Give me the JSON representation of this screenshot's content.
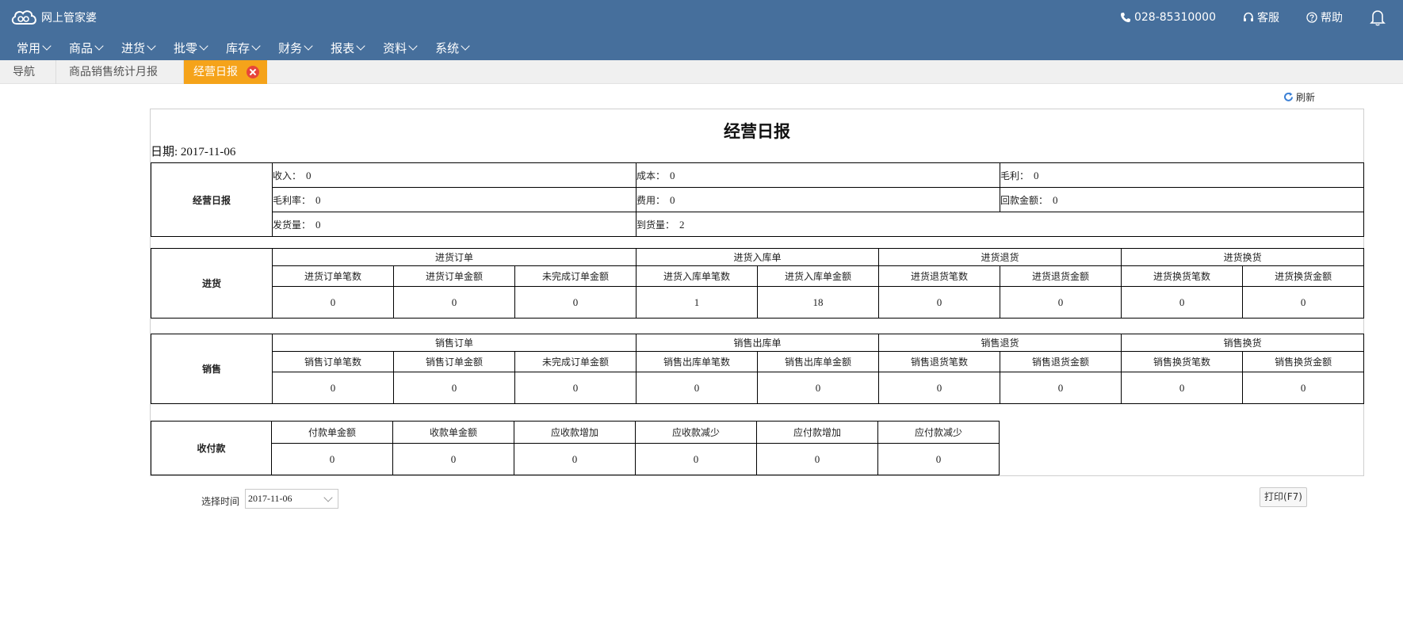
{
  "app": {
    "logo_text": "网上管家婆"
  },
  "topbar": {
    "phone": "028-85310000",
    "service": "客服",
    "help": "帮助"
  },
  "menu": [
    "常用",
    "商品",
    "进货",
    "批零",
    "库存",
    "财务",
    "报表",
    "资料",
    "系统"
  ],
  "tabs": [
    "导航",
    "商品销售统计月报",
    "经营日报"
  ],
  "toolbar": {
    "refresh": "刷新"
  },
  "report": {
    "title": "经营日报",
    "date_label": "日期:",
    "date_value": "2017-11-06",
    "summary": {
      "header": "经营日报",
      "income_label": "收入：",
      "income": "0",
      "cost_label": "成本：",
      "cost": "0",
      "gross_label": "毛利：",
      "gross": "0",
      "margin_label": "毛利率：",
      "margin": "0",
      "expense_label": "费用：",
      "expense": "0",
      "refund_label": "回款金额：",
      "refund": "0",
      "ship_label": "发货量：",
      "ship": "0",
      "arrive_label": "到货量：",
      "arrive": "2"
    },
    "purchase": {
      "header": "进货",
      "groups": [
        "进货订单",
        "进货入库单",
        "进货退货",
        "进货换货"
      ],
      "columns": [
        "进货订单笔数",
        "进货订单金额",
        "未完成订单金额",
        "进货入库单笔数",
        "进货入库单金额",
        "进货退货笔数",
        "进货退货金额",
        "进货换货笔数",
        "进货换货金额"
      ],
      "values": [
        "0",
        "0",
        "0",
        "1",
        "18",
        "0",
        "0",
        "0",
        "0"
      ]
    },
    "sales": {
      "header": "销售",
      "groups": [
        "销售订单",
        "销售出库单",
        "销售退货",
        "销售换货"
      ],
      "columns": [
        "销售订单笔数",
        "销售订单金额",
        "未完成订单金额",
        "销售出库单笔数",
        "销售出库单金额",
        "销售退货笔数",
        "销售退货金额",
        "销售换货笔数",
        "销售换货金额"
      ],
      "values": [
        "0",
        "0",
        "0",
        "0",
        "0",
        "0",
        "0",
        "0",
        "0"
      ]
    },
    "payments": {
      "header": "收付款",
      "columns": [
        "付款单金额",
        "收款单金额",
        "应收款增加",
        "应收款减少",
        "应付款增加",
        "应付款减少"
      ],
      "values": [
        "0",
        "0",
        "0",
        "0",
        "0",
        "0"
      ]
    }
  },
  "footer": {
    "time_label": "选择时间",
    "time_value": "2017-11-06",
    "print": "打印(F7)"
  }
}
